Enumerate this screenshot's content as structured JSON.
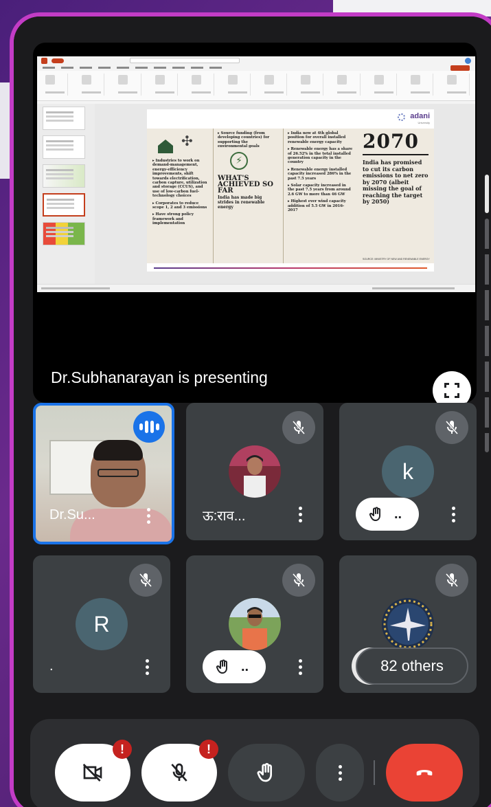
{
  "meeting": {
    "presenting_text": "Dr.Subhanarayan is presenting"
  },
  "slide": {
    "brand": "adani",
    "brand_sub": "University",
    "col1": [
      "▸ Industries to work on demand-management, energy-efficiency improvements, shift towards electrification, carbon capture, utilization and storage (CCUS), and use of low-carbon fuel-technology choices",
      "▸ Corporates to reduce scope 1, 2 and 3 emissions",
      "▸ Have strong policy framework and implementation"
    ],
    "col2_top": "▸ Source funding (from developing countries) for supporting the environmental goals",
    "col2_heading": "WHAT'S ACHIEVED SO FAR",
    "col2_sub": "India has made big strides in renewable energy",
    "col3": [
      "▸ India now at 4th global position for overall installed renewable energy capacity",
      "▸ Renewable energy has a share of 26.52% in the total installed generation capacity in the country",
      "▸ Renewable energy installed capacity increased 286% in the past 7.5 years",
      "▸ Solar capacity increased in the past 7.5 years from around 2.6 GW to more than 46 GW",
      "▸ Highest ever wind capacity addition of 5.5 GW in 2016-2017"
    ],
    "year": "2070",
    "year_text": "India has promised to cut its carbon emissions to net zero by 2070 (albeit missing the goal of reaching the target by 2050)",
    "source": "SOURCE: MINISTRY OF NEW AND RENEWABLE ENERGY"
  },
  "participants": [
    {
      "name": "Dr.Su...",
      "speaking": true
    },
    {
      "name": "ऊ:राव...",
      "muted": true
    },
    {
      "initial": "k",
      "muted": true,
      "hand_label": ".."
    },
    {
      "initial": "R",
      "name": ".",
      "muted": true
    },
    {
      "muted": true,
      "hand_label": ".."
    },
    {
      "muted": true,
      "others_label": "82 others"
    }
  ],
  "controls": {
    "camera_alert": "!",
    "mic_alert": "!"
  },
  "colors": {
    "frame_border": "#c33cc6",
    "tile_bg": "#3c4043",
    "active_border": "#1a73e8",
    "leave_red": "#ea4335",
    "alert_red": "#c5221f"
  }
}
